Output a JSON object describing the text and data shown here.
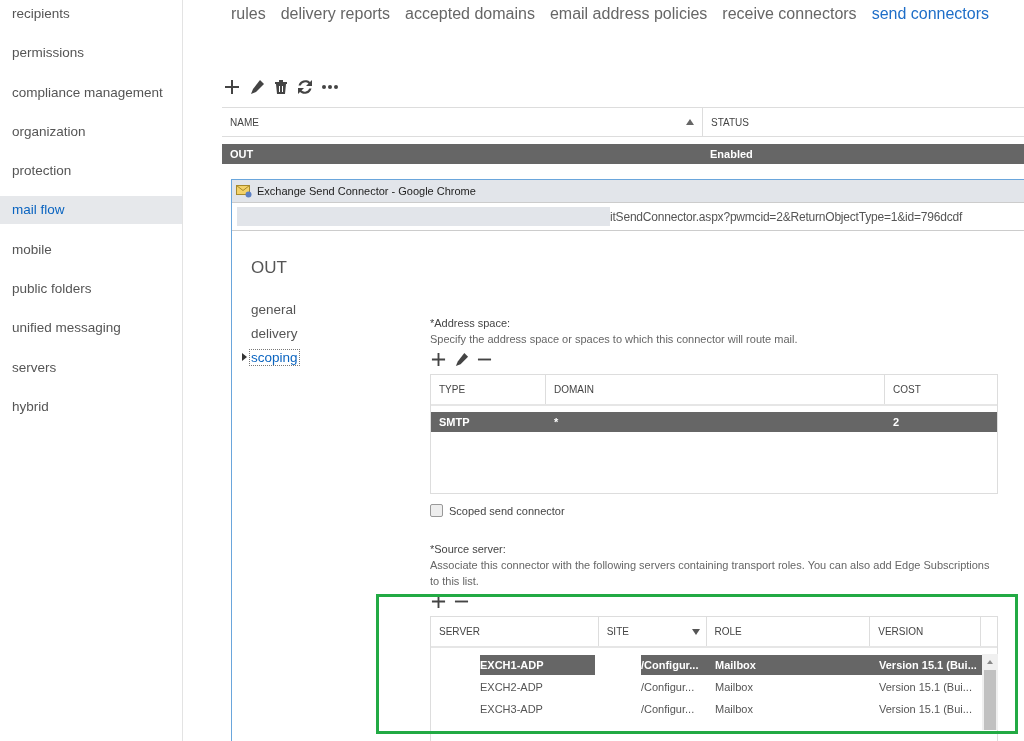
{
  "sidebar": {
    "items": [
      {
        "label": "recipients",
        "selected": false
      },
      {
        "label": "permissions",
        "selected": false
      },
      {
        "label": "compliance management",
        "selected": false
      },
      {
        "label": "organization",
        "selected": false
      },
      {
        "label": "protection",
        "selected": false
      },
      {
        "label": "mail flow",
        "selected": true
      },
      {
        "label": "mobile",
        "selected": false
      },
      {
        "label": "public folders",
        "selected": false
      },
      {
        "label": "unified messaging",
        "selected": false
      },
      {
        "label": "servers",
        "selected": false
      },
      {
        "label": "hybrid",
        "selected": false
      }
    ]
  },
  "tabs": [
    {
      "label": "rules",
      "selected": false
    },
    {
      "label": "delivery reports",
      "selected": false
    },
    {
      "label": "accepted domains",
      "selected": false
    },
    {
      "label": "email address policies",
      "selected": false
    },
    {
      "label": "receive connectors",
      "selected": false
    },
    {
      "label": "send connectors",
      "selected": true
    }
  ],
  "connectors": {
    "columns": [
      {
        "label": "NAME",
        "sorted": true
      },
      {
        "label": "STATUS",
        "sorted": false
      }
    ],
    "rows": [
      {
        "name": "OUT",
        "status": "Enabled",
        "selected": true
      }
    ]
  },
  "popup": {
    "window_title": "Exchange Send Connector - Google Chrome",
    "url": "itSendConnector.aspx?pwmcid=2&ReturnObjectType=1&id=796dcdf",
    "heading": "OUT",
    "nav": [
      {
        "label": "general",
        "selected": false
      },
      {
        "label": "delivery",
        "selected": false
      },
      {
        "label": "scoping",
        "selected": true
      }
    ],
    "address_space": {
      "label": "*Address space:",
      "description": "Specify the address space or spaces to which this connector will route mail.",
      "columns": [
        "TYPE",
        "DOMAIN",
        "COST"
      ],
      "rows": [
        {
          "type": "SMTP",
          "domain": "*",
          "cost": "2",
          "selected": true
        }
      ]
    },
    "scoped": {
      "label": "Scoped send connector",
      "checked": false
    },
    "source_server": {
      "label": "*Source server:",
      "description": "Associate this connector with the following servers containing transport roles. You can also add Edge Subscriptions to this list.",
      "columns": [
        {
          "label": "SERVER",
          "filter": false
        },
        {
          "label": "SITE",
          "filter": true
        },
        {
          "label": "ROLE",
          "filter": false
        },
        {
          "label": "VERSION",
          "filter": false
        }
      ],
      "rows": [
        {
          "server": "EXCH1-ADP",
          "site": "/Configur...",
          "role": "Mailbox",
          "version": "Version 15.1 (Bui...",
          "selected": true
        },
        {
          "server": "EXCH2-ADP",
          "site": "/Configur...",
          "role": "Mailbox",
          "version": "Version 15.1 (Bui...",
          "selected": false
        },
        {
          "server": "EXCH3-ADP",
          "site": "/Configur...",
          "role": "Mailbox",
          "version": "Version 15.1 (Bui...",
          "selected": false
        }
      ]
    }
  }
}
